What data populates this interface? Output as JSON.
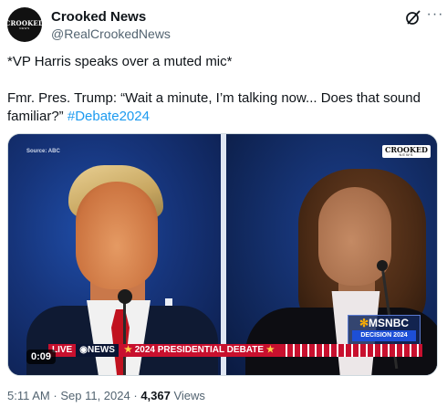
{
  "account": {
    "name": "Crooked News",
    "handle": "@RealCrookedNews",
    "avatar_text": "CROOKED",
    "avatar_sub": "NEWS"
  },
  "icons": {
    "grok": "grok-icon",
    "more": "more-options-icon"
  },
  "tweet": {
    "line1": "*VP Harris speaks over a muted mic*",
    "line2": "Fmr. Pres. Trump: “Wait a minute, I’m talking now... Does that sound familiar?”",
    "hashtag": "#Debate2024"
  },
  "media": {
    "source_label": "Source: ABC",
    "logo_top": "CROOKED",
    "logo_bottom": "NEWS",
    "network": "MSNBC",
    "decision_banner": "DECISION 2024",
    "lower_third_live": "LIVE",
    "lower_third_network": "NEWS",
    "lower_third_event": "2024 PRESIDENTIAL DEBATE",
    "duration": "0:09"
  },
  "meta": {
    "time": "5:11 AM",
    "separator": "·",
    "date": "Sep 11, 2024",
    "views_count": "4,367",
    "views_label": "Views"
  },
  "colors": {
    "link": "#1d9bf0",
    "text_secondary": "#536471",
    "text_primary": "#0f1419"
  }
}
